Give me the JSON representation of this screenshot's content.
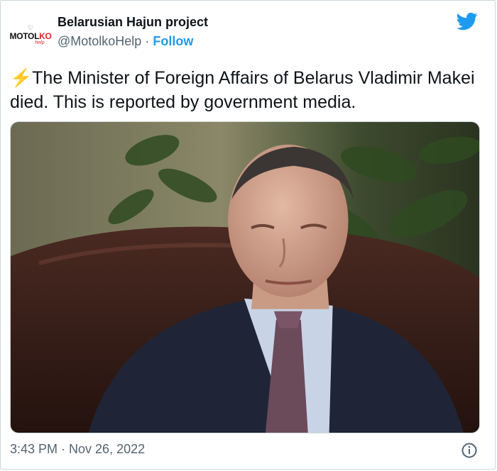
{
  "account": {
    "avatar_logo_top": "♡",
    "avatar_logo_main_black": "MOTOL",
    "avatar_logo_main_red": "KO",
    "avatar_logo_sub": "help",
    "display_name": "Belarusian Hajun project",
    "handle": "@MotolkoHelp",
    "separator": " · ",
    "follow_label": "Follow"
  },
  "tweet": {
    "emoji": "⚡",
    "text": "The Minister of Foreign Affairs of Belarus Vladimir Makei died. This is reported by government media."
  },
  "footer": {
    "timestamp": "3:43 PM · Nov 26, 2022"
  },
  "colors": {
    "brand_blue": "#1d9bf0",
    "text_secondary": "#536471",
    "text_primary": "#0f1419"
  },
  "icons": [
    "twitter-bird-icon",
    "info-icon"
  ]
}
